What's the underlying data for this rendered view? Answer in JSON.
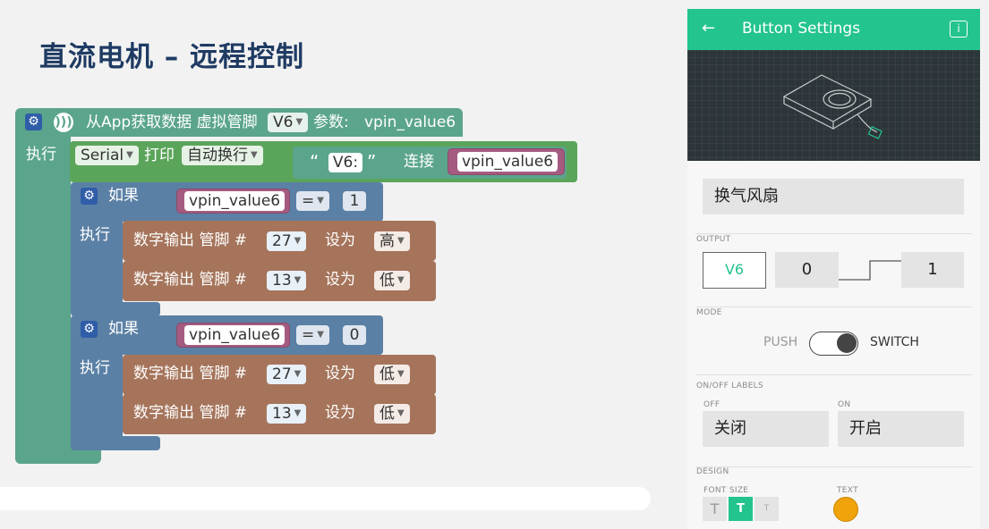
{
  "slide": {
    "title": "直流电机 – 远程控制"
  },
  "blocks": {
    "hat": {
      "label": "从App获取数据 虚拟管脚",
      "pin": "V6",
      "param_label": "参数:",
      "param": "vpin_value6",
      "exec": "执行"
    },
    "serial": {
      "name": "Serial",
      "print": "打印",
      "mode": "自动换行",
      "text": "V6:",
      "join": "连接",
      "var": "vpin_value6"
    },
    "if1": {
      "label": "如果",
      "var": "vpin_value6",
      "op": "=",
      "value": "1",
      "exec": "执行",
      "rows": [
        {
          "label": "数字输出 管脚 #",
          "pin": "27",
          "set": "设为",
          "level": "高"
        },
        {
          "label": "数字输出 管脚 #",
          "pin": "13",
          "set": "设为",
          "level": "低"
        }
      ]
    },
    "if2": {
      "label": "如果",
      "var": "vpin_value6",
      "op": "=",
      "value": "0",
      "exec": "执行",
      "rows": [
        {
          "label": "数字输出 管脚 #",
          "pin": "27",
          "set": "设为",
          "level": "低"
        },
        {
          "label": "数字输出 管脚 #",
          "pin": "13",
          "set": "设为",
          "level": "低"
        }
      ]
    }
  },
  "settings": {
    "header_title": "Button Settings",
    "name_value": "换气风扇",
    "output_label": "OUTPUT",
    "output_pin": "V6",
    "output_low": "0",
    "output_high": "1",
    "mode_label": "MODE",
    "mode_push": "PUSH",
    "mode_switch": "SWITCH",
    "mode_selected": "SWITCH",
    "labels_section": "ON/OFF LABELS",
    "off_caption": "OFF",
    "on_caption": "ON",
    "off_value": "关闭",
    "on_value": "开启",
    "design_label": "DESIGN",
    "font_size_label": "FONT SIZE",
    "text_label": "TEXT",
    "font_sizes": [
      "T",
      "T",
      "T"
    ],
    "font_size_selected": 1,
    "text_color": "#f0a30a",
    "accent": "#23c48e"
  }
}
